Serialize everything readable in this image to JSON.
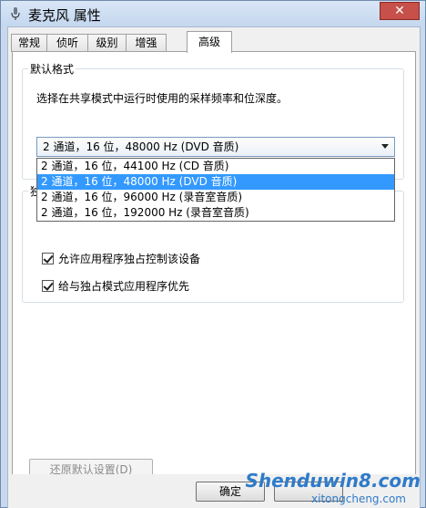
{
  "window": {
    "title": "麦克风 属性",
    "close_label": "✕"
  },
  "tabs": [
    {
      "label": "常规"
    },
    {
      "label": "侦听"
    },
    {
      "label": "级别"
    },
    {
      "label": "增强"
    },
    {
      "label": "高级"
    }
  ],
  "default_format": {
    "group_title": "默认格式",
    "description": "选择在共享模式中运行时使用的采样频率和位深度。",
    "selected_value": "2 通道，16 位，48000 Hz (DVD 音质)",
    "options": [
      "2 通道，16 位，44100 Hz (CD 音质)",
      "2 通道，16 位，48000 Hz (DVD 音质)",
      "2 通道，16 位，96000 Hz (录音室音质)",
      "2 通道，16 位，192000 Hz (录音室音质)"
    ]
  },
  "exclusive_mode": {
    "group_title": "独",
    "allow_exclusive_label": "允许应用程序独占控制该设备",
    "priority_label": "给与独占模式应用程序优先"
  },
  "buttons": {
    "restore_defaults": "还原默认设置(D)",
    "ok": "确定"
  },
  "watermark": {
    "main": "Shenduwin8.com",
    "sub": "xitongcheng.com"
  },
  "colors": {
    "selection": "#3399ff",
    "close_button": "#c7504a"
  }
}
